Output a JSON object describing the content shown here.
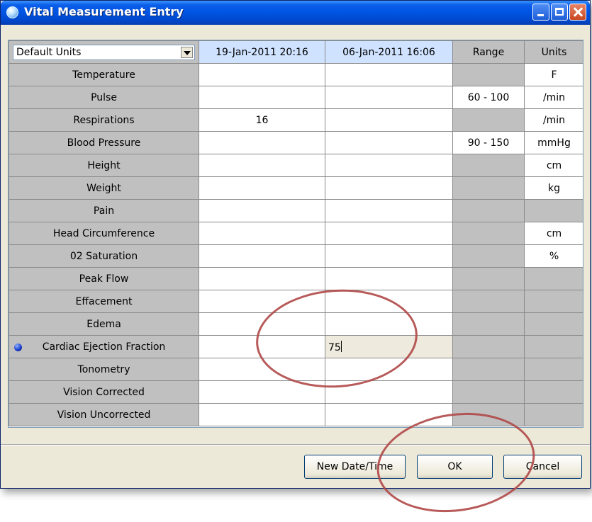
{
  "window": {
    "title": "Vital Measurement Entry"
  },
  "grid": {
    "units_dropdown": "Default Units",
    "columns": [
      "19-Jan-2011 20:16",
      "06-Jan-2011 16:06",
      "Range",
      "Units"
    ],
    "rows": [
      {
        "label": "Temperature",
        "v1": "",
        "v2": "",
        "range": "",
        "units": "F"
      },
      {
        "label": "Pulse",
        "v1": "",
        "v2": "",
        "range": "60 - 100",
        "units": "/min"
      },
      {
        "label": "Respirations",
        "v1": "16",
        "v2": "",
        "range": "",
        "units": "/min"
      },
      {
        "label": "Blood Pressure",
        "v1": "",
        "v2": "",
        "range": "90 - 150",
        "units": "mmHg"
      },
      {
        "label": "Height",
        "v1": "",
        "v2": "",
        "range": "",
        "units": "cm"
      },
      {
        "label": "Weight",
        "v1": "",
        "v2": "",
        "range": "",
        "units": "kg"
      },
      {
        "label": "Pain",
        "v1": "",
        "v2": "",
        "range": "",
        "units": ""
      },
      {
        "label": "Head Circumference",
        "v1": "",
        "v2": "",
        "range": "",
        "units": "cm"
      },
      {
        "label": "02 Saturation",
        "v1": "",
        "v2": "",
        "range": "",
        "units": "%"
      },
      {
        "label": "Peak Flow",
        "v1": "",
        "v2": "",
        "range": "",
        "units": ""
      },
      {
        "label": "Effacement",
        "v1": "",
        "v2": "",
        "range": "",
        "units": ""
      },
      {
        "label": "Edema",
        "v1": "",
        "v2": "",
        "range": "",
        "units": ""
      },
      {
        "label": "Cardiac Ejection Fraction",
        "v1": "",
        "v2": "75",
        "range": "",
        "units": ""
      },
      {
        "label": "Tonometry",
        "v1": "",
        "v2": "",
        "range": "",
        "units": ""
      },
      {
        "label": "Vision Corrected",
        "v1": "",
        "v2": "",
        "range": "",
        "units": ""
      },
      {
        "label": "Vision Uncorrected",
        "v1": "",
        "v2": "",
        "range": "",
        "units": ""
      }
    ]
  },
  "buttons": {
    "new_datetime": "New Date/Time",
    "ok": "OK",
    "cancel": "Cancel"
  },
  "colors": {
    "title_bar": "#0054e3",
    "annotation": "#b04848",
    "window_bg": "#ece9d8"
  }
}
